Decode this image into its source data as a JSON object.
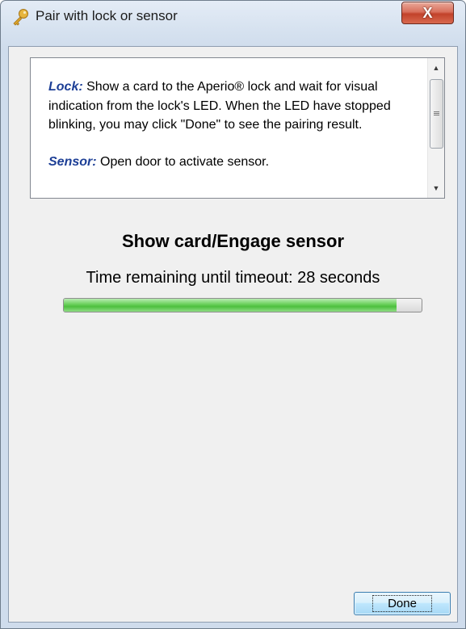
{
  "window": {
    "title": "Pair with lock or sensor",
    "close_label": "X"
  },
  "instructions": {
    "lock_keyword": "Lock:",
    "lock_text": " Show a card to the Aperio® lock and wait for visual indication from the lock's LED. When the LED have stopped blinking, you may click \"Done\" to see the pairing result.",
    "sensor_keyword": "Sensor:",
    "sensor_text": " Open door to activate sensor."
  },
  "status": {
    "heading": "Show card/Engage sensor",
    "timeout_text": "Time remaining until timeout: 28 seconds",
    "progress_fraction": 0.93
  },
  "buttons": {
    "done_label": "Done"
  },
  "colors": {
    "keyword": "#1d3f96",
    "progress_green": "#4dbf3e",
    "close_red": "#c2422a"
  },
  "icons": {
    "title": "key-icon"
  }
}
